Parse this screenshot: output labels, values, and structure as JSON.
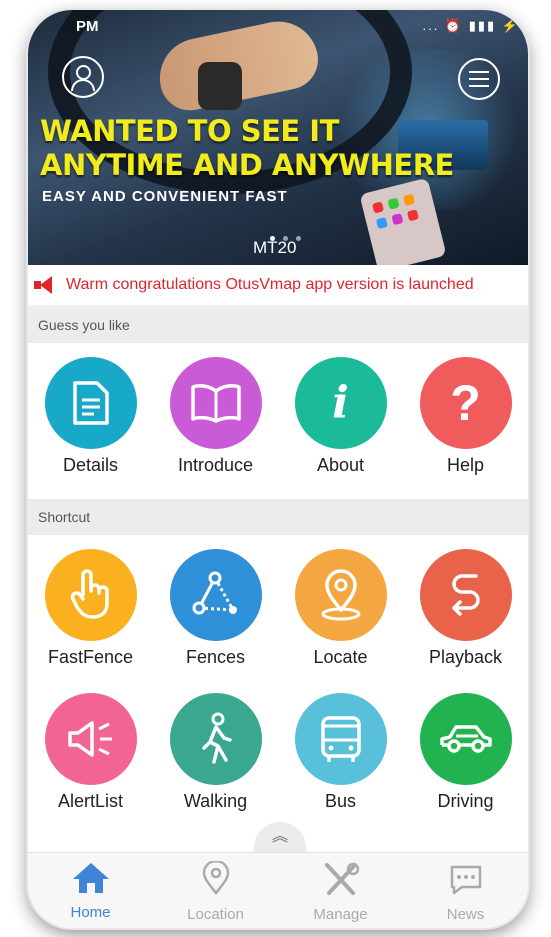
{
  "status": {
    "time": "PM",
    "icons": "... ⏰ ▮▮▮ ⚡"
  },
  "banner": {
    "headline1": "WANTED TO SEE IT",
    "headline2": "ANYTIME AND ANYWHERE",
    "subline": "EASY AND CONVENIENT FAST",
    "model": "MT20",
    "accent": "#f2ec1c",
    "icons": {
      "left": "user-icon",
      "right": "menu-icon"
    }
  },
  "notice": {
    "text": "Warm congratulations OtusVmap app version is launched",
    "color": "#e0262c"
  },
  "sections": {
    "guess": "Guess you like",
    "shortcut": "Shortcut"
  },
  "guess_items": [
    {
      "label": "Details",
      "color": "#18a9c9",
      "icon": "document-icon"
    },
    {
      "label": "Introduce",
      "color": "#c95bd6",
      "icon": "book-icon"
    },
    {
      "label": "About",
      "color": "#1bba98",
      "icon": "info-icon"
    },
    {
      "label": "Help",
      "color": "#f05b5b",
      "icon": "question-icon"
    }
  ],
  "shortcut_items": [
    {
      "label": "FastFence",
      "color": "#fbb020",
      "icon": "hand-pointer-icon"
    },
    {
      "label": "Fences",
      "color": "#2f8fd8",
      "icon": "fence-nodes-icon"
    },
    {
      "label": "Locate",
      "color": "#f4a740",
      "icon": "location-pin-icon"
    },
    {
      "label": "Playback",
      "color": "#e9634b",
      "icon": "playback-route-icon"
    },
    {
      "label": "AlertList",
      "color": "#f26593",
      "icon": "megaphone-icon"
    },
    {
      "label": "Walking",
      "color": "#3aa890",
      "icon": "walking-icon"
    },
    {
      "label": "Bus",
      "color": "#58c0d8",
      "icon": "bus-icon"
    },
    {
      "label": "Driving",
      "color": "#21b34f",
      "icon": "car-icon"
    }
  ],
  "tabs": [
    {
      "label": "Home",
      "icon": "home-icon",
      "active": true
    },
    {
      "label": "Location",
      "icon": "location-icon"
    },
    {
      "label": "Manage",
      "icon": "tools-icon"
    },
    {
      "label": "News",
      "icon": "chat-icon"
    }
  ],
  "colors": {
    "tab_active": "#3f84d6",
    "tab_inactive": "#aaaaaa"
  }
}
